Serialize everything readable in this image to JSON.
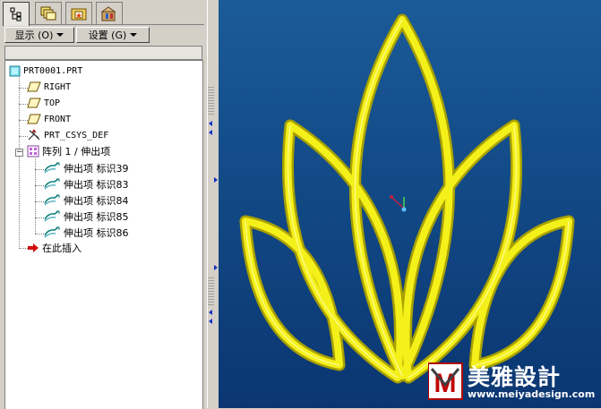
{
  "tabs": [
    {
      "icon": "model-tree-icon",
      "active": true
    },
    {
      "icon": "layers-icon",
      "active": false
    },
    {
      "icon": "folder-browser-icon",
      "active": false
    },
    {
      "icon": "favorites-icon",
      "active": false
    }
  ],
  "toolbar": {
    "show_label": "显示 (O)",
    "settings_label": "设置 (G)"
  },
  "tree": {
    "root": "PRT0001.PRT",
    "planes": [
      "RIGHT",
      "TOP",
      "FRONT"
    ],
    "csys": "PRT_CSYS_DEF",
    "pattern": "阵列 1 / 伸出项",
    "extrudes": [
      "伸出项 标识39",
      "伸出项 标识83",
      "伸出项 标识84",
      "伸出项 标识85",
      "伸出项 标识86"
    ],
    "insert_here": "在此插入"
  },
  "viewport": {
    "background_top": "#1b5b98",
    "background_bottom": "#0b3672",
    "model_color": "#f4f01a",
    "model_edge_color": "#b8b000"
  },
  "watermark": {
    "logo_text": "M",
    "brand": "美雅設計",
    "url": "www.meiyadesign.com"
  }
}
